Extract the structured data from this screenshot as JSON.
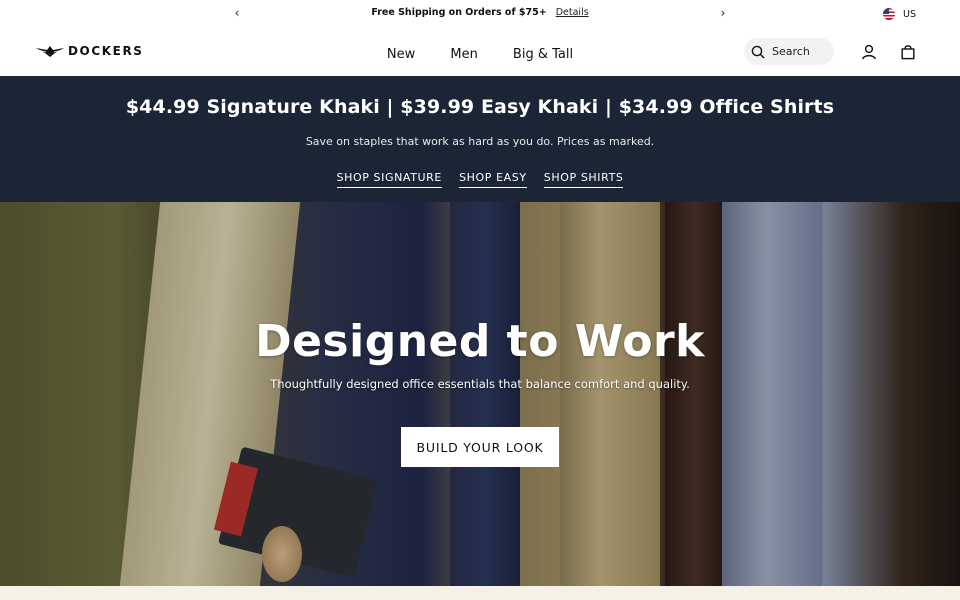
{
  "announcement": {
    "message": "Free Shipping on Orders of $75+",
    "details_link": "Details",
    "prev_icon": "chevron-left-icon",
    "next_icon": "chevron-right-icon",
    "locale": "US"
  },
  "header": {
    "logo_text": "DOCKERS",
    "nav": [
      "New",
      "Men",
      "Big & Tall"
    ],
    "search": {
      "placeholder": "Search"
    },
    "icons": [
      "search-icon",
      "account-icon",
      "bag-icon"
    ]
  },
  "promo": {
    "headline": "$44.99 Signature Khaki | $39.99 Easy Khaki | $34.99 Office Shirts",
    "subtext": "Save on staples that work as hard as you do. Prices as marked.",
    "links": [
      "SHOP SIGNATURE",
      "SHOP EASY",
      "SHOP SHIRTS"
    ]
  },
  "hero": {
    "title": "Designed to Work",
    "description": "Thoughtfully designed office essentials that balance comfort and quality.",
    "cta": "BUILD YOUR LOOK"
  },
  "colors": {
    "promo_bg": "#1b2536",
    "below_bg": "#f6f1e6"
  }
}
